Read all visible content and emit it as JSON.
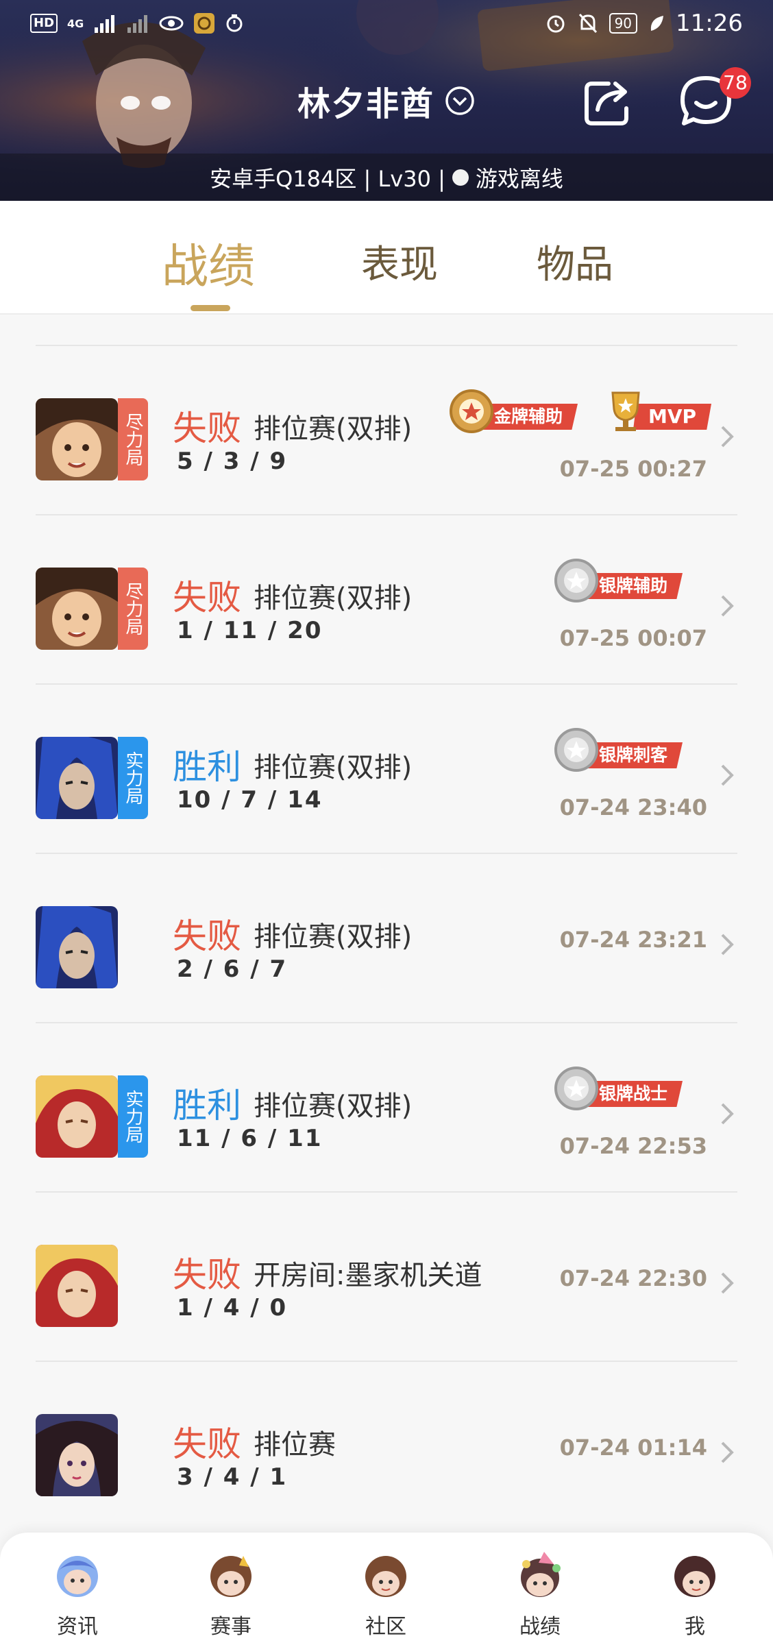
{
  "status_bar": {
    "left_icons": [
      "hd-icon",
      "4g-signal-icon",
      "signal-icon",
      "eye-icon",
      "app-icon",
      "timer-icon"
    ],
    "hd": "HD",
    "net": "4G",
    "battery": "90",
    "time": "11:26"
  },
  "header": {
    "player_name": "林夕非酋",
    "message_badge": "78",
    "info_prefix": "安卓手Q184区 | Lv30 |",
    "status": "游戏离线"
  },
  "tabs": [
    {
      "label": "战绩",
      "active": true
    },
    {
      "label": "表现",
      "active": false
    },
    {
      "label": "物品",
      "active": false
    }
  ],
  "matches": [
    {
      "result": "失败",
      "outcome": "lose",
      "mode": "排位赛(双排)",
      "kda": "5 / 3 / 9",
      "time": "07-25 00:27",
      "tag": "尽力局",
      "badges": [
        "金牌辅助",
        "MVP"
      ]
    },
    {
      "result": "失败",
      "outcome": "lose",
      "mode": "排位赛(双排)",
      "kda": "1 / 11 / 20",
      "time": "07-25 00:07",
      "tag": "尽力局",
      "badges": [
        "银牌辅助"
      ]
    },
    {
      "result": "胜利",
      "outcome": "win",
      "mode": "排位赛(双排)",
      "kda": "10 / 7 / 14",
      "time": "07-24 23:40",
      "tag": "实力局",
      "badges": [
        "银牌刺客"
      ]
    },
    {
      "result": "失败",
      "outcome": "lose",
      "mode": "排位赛(双排)",
      "kda": "2 / 6 / 7",
      "time": "07-24 23:21",
      "tag": "",
      "badges": []
    },
    {
      "result": "胜利",
      "outcome": "win",
      "mode": "排位赛(双排)",
      "kda": "11 / 6 / 11",
      "time": "07-24 22:53",
      "tag": "实力局",
      "badges": [
        "银牌战士"
      ]
    },
    {
      "result": "失败",
      "outcome": "lose",
      "mode": "开房间:墨家机关道",
      "kda": "1 / 4 / 0",
      "time": "07-24 22:30",
      "tag": "",
      "badges": []
    },
    {
      "result": "失败",
      "outcome": "lose",
      "mode": "排位赛",
      "kda": "3 / 4 / 1",
      "time": "07-24 01:14",
      "tag": "",
      "badges": []
    }
  ],
  "bottom_nav": [
    {
      "label": "资讯",
      "icon": "news-avatar-icon"
    },
    {
      "label": "赛事",
      "icon": "events-avatar-icon"
    },
    {
      "label": "社区",
      "icon": "community-avatar-icon"
    },
    {
      "label": "战绩",
      "icon": "record-avatar-icon"
    },
    {
      "label": "我",
      "icon": "me-avatar-icon"
    }
  ],
  "colors": {
    "accent_gold": "#c9a55c",
    "lose_red": "#e45a43",
    "win_blue": "#2d90e0",
    "badge_red": "#e0483a",
    "header_navy": "#22254a"
  }
}
